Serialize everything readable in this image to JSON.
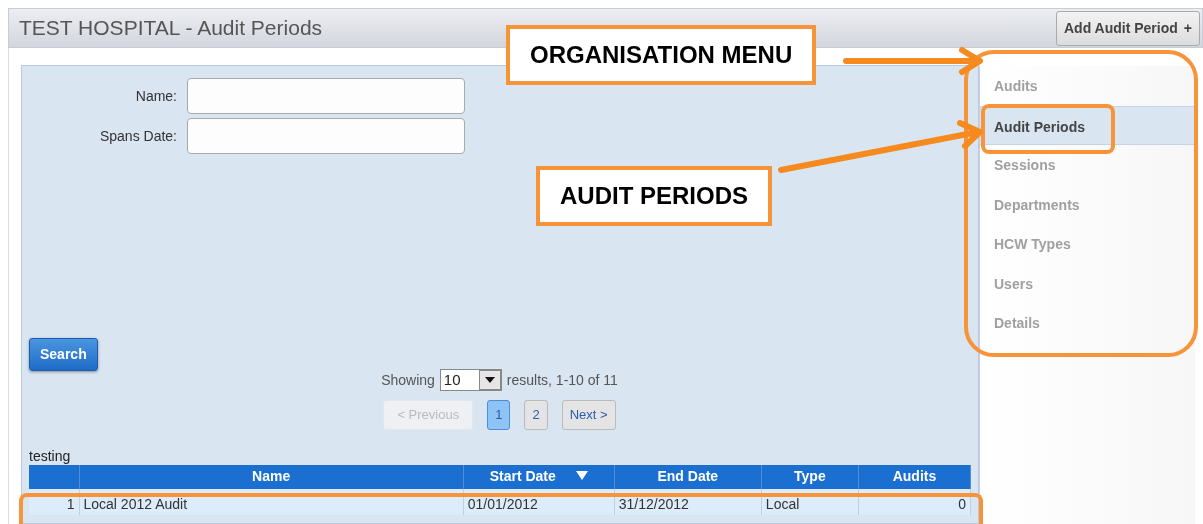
{
  "header": {
    "title": "TEST HOSPITAL - Audit Periods",
    "add_button": {
      "label": "Add Audit Period",
      "icon": "+"
    }
  },
  "filters": [
    {
      "label": "Name:"
    },
    {
      "label": "Spans Date:"
    }
  ],
  "search_button": "Search",
  "paging": {
    "showing": "Showing",
    "page_size": "10",
    "summary": "results, 1-10 of 11",
    "previous": {
      "label": "< Previous",
      "disabled": true
    },
    "pages": [
      {
        "label": "1",
        "selected": true
      },
      {
        "label": "2",
        "selected": false
      }
    ],
    "next": {
      "label": "Next >",
      "disabled": false
    }
  },
  "table": {
    "caption": "testing",
    "columns": [
      {
        "sorted": false
      },
      {
        "label": "Name",
        "sorted": false
      },
      {
        "label": "Start Date",
        "sorted": true
      },
      {
        "label": "End Date",
        "sorted": false
      },
      {
        "label": "Type",
        "sorted": false
      },
      {
        "label": "Audits",
        "sorted": false
      }
    ],
    "rows": [
      {
        "cells": [
          "1",
          "Local 2012 Audit",
          "01/01/2012",
          "31/12/2012",
          "Local",
          "0"
        ]
      }
    ]
  },
  "sidebar": {
    "items": [
      {
        "label": "Audits",
        "selected": false
      },
      {
        "label": "Audit Periods",
        "selected": true
      },
      {
        "label": "Sessions",
        "selected": false
      },
      {
        "label": "Departments",
        "selected": false
      },
      {
        "label": "HCW Types",
        "selected": false
      },
      {
        "label": "Users",
        "selected": false
      },
      {
        "label": "Details",
        "selected": false
      }
    ]
  },
  "annotations": [
    {
      "label": "ORGANISATION MENU"
    },
    {
      "label": "AUDIT PERIODS"
    }
  ]
}
